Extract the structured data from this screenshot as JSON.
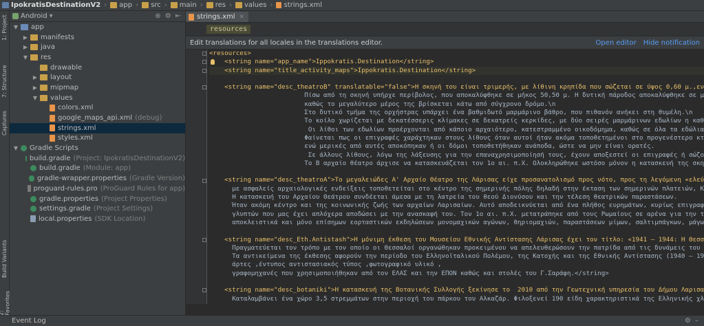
{
  "breadcrumbs": [
    "IpokratisDestinationV2",
    "app",
    "src",
    "main",
    "res",
    "values",
    "strings.xml"
  ],
  "left_toolwindows": [
    "1: Project",
    "7: Structure",
    "Captures",
    "Build Variants",
    "2: Favorites"
  ],
  "project_panel": {
    "view_mode": "Android",
    "tree": [
      {
        "label": "app",
        "hint": "",
        "indent": 0,
        "arrow": "▼",
        "icon": "folder-blue"
      },
      {
        "label": "manifests",
        "hint": "",
        "indent": 1,
        "arrow": "▶",
        "icon": "folder"
      },
      {
        "label": "java",
        "hint": "",
        "indent": 1,
        "arrow": "▶",
        "icon": "folder"
      },
      {
        "label": "res",
        "hint": "",
        "indent": 1,
        "arrow": "▼",
        "icon": "folder"
      },
      {
        "label": "drawable",
        "hint": "",
        "indent": 2,
        "arrow": "",
        "icon": "folder"
      },
      {
        "label": "layout",
        "hint": "",
        "indent": 2,
        "arrow": "▶",
        "icon": "folder"
      },
      {
        "label": "mipmap",
        "hint": "",
        "indent": 2,
        "arrow": "▶",
        "icon": "folder"
      },
      {
        "label": "values",
        "hint": "",
        "indent": 2,
        "arrow": "▼",
        "icon": "folder"
      },
      {
        "label": "colors.xml",
        "hint": "",
        "indent": 3,
        "arrow": "",
        "icon": "xml"
      },
      {
        "label": "google_maps_api.xml",
        "hint": "(debug)",
        "indent": 3,
        "arrow": "",
        "icon": "xml"
      },
      {
        "label": "strings.xml",
        "hint": "",
        "indent": 3,
        "arrow": "",
        "icon": "xml",
        "selected": true
      },
      {
        "label": "styles.xml",
        "hint": "",
        "indent": 3,
        "arrow": "",
        "icon": "xml"
      },
      {
        "label": "Gradle Scripts",
        "hint": "",
        "indent": 0,
        "arrow": "▼",
        "icon": "gradle"
      },
      {
        "label": "build.gradle",
        "hint": "(Project: IpokratisDestinationV2)",
        "indent": 1,
        "arrow": "",
        "icon": "gradle"
      },
      {
        "label": "build.gradle",
        "hint": "(Module: app)",
        "indent": 1,
        "arrow": "",
        "icon": "gradle"
      },
      {
        "label": "gradle-wrapper.properties",
        "hint": "(Gradle Version)",
        "indent": 1,
        "arrow": "",
        "icon": "gradle"
      },
      {
        "label": "proguard-rules.pro",
        "hint": "(ProGuard Rules for app)",
        "indent": 1,
        "arrow": "",
        "icon": "pro"
      },
      {
        "label": "gradle.properties",
        "hint": "(Project Properties)",
        "indent": 1,
        "arrow": "",
        "icon": "gradle"
      },
      {
        "label": "settings.gradle",
        "hint": "(Project Settings)",
        "indent": 1,
        "arrow": "",
        "icon": "gradle"
      },
      {
        "label": "local.properties",
        "hint": "(SDK Location)",
        "indent": 1,
        "arrow": "",
        "icon": "props"
      }
    ]
  },
  "editor": {
    "tab_label": "strings.xml",
    "breadcrumb_chip": "resources",
    "notice_text": "Edit translations for all locales in the translations editor.",
    "open_editor": "Open editor",
    "hide_notification": "Hide notification",
    "lines": [
      {
        "text": "<resources>",
        "kind": "tag"
      },
      {
        "text": "    <string name=\"app_name\">Ippokratis.Destination</string>",
        "kind": "str"
      },
      {
        "text": "    <string name=\"title_activity_maps\">Ippokratis.Destination</string>",
        "kind": "str",
        "highlight": true
      },
      {
        "text": "",
        "kind": "plain"
      },
      {
        "text": "    <string name=\"desc_theatroB\" translatable=\"false\">Η σκηνή του είναι τριμερής, με λίθινη κρηπίδα που σώζεται σε ύψος 0,60 μ.,ενώ το ανάτερ",
        "kind": "str"
      },
      {
        "text": "                         Πίσω από τη σκηνή υπήρχε περίβολος, που αποκαλύφθηκε σε μήκος 50,50 μ. Η δυτική πάροδος αποκαλύφθηκε σε μήκος 9 μ.,",
        "kind": "plain"
      },
      {
        "text": "                         καθώς το μεγαλύτερο μέρος της βρίσκεται κάτω από σύγχρονο δρόμο.\\n",
        "kind": "plain"
      },
      {
        "text": "                         Στο δυτικό τμήμα της ορχήστρας υπάρχει ένα βαθμιδωτό μαρμάρινο βάθρο, που πιθανόν ανήκει στη θυμέλη.\\n",
        "kind": "plain"
      },
      {
        "text": "                         Το κοίλο χωρίζεται με δεκατέσσερις κλίμακες σε δεκατρείς κερκίδες, με δύο σειρές μαρμάρινων εδωλίων η καθεμιά.",
        "kind": "plain"
      },
      {
        "text": "                          Οι λίθοι των εδωλίων προέρχονται από κάποιο αρχαιότερο, κατεστραμμένο οικοδόμημα, καθώς σε όλα τα εδώλια υπάρχουν απ",
        "kind": "plain"
      },
      {
        "text": "                         Φαίνεται πως οι επιγραφές χαράχτηκαν στους λίθους όταν αυτοί ήταν ακόμα τοποθετημένοι στο προγενέστερο κτίριο, επειδή",
        "kind": "plain"
      },
      {
        "text": "                         ενώ μερικές από αυτές αποκόπηκαν ή οι δόμοι τοποθετήθηκαν ανάποδα, ώστε να μην είναι ορατές.",
        "kind": "plain"
      },
      {
        "text": "                          Σε άλλους λίθους, λόγω της λάξευσης για την επαναχρησιμοποίησή τους, έχουν αποξεστεί οι επιγραφές ή σώζονται ελάχιστ",
        "kind": "plain"
      },
      {
        "text": "                         Το Β αρχαίο θέατρο άρχισε να κατασκευάζεται τον 1ο αι. π.Χ. Ολοκληρώθηκε ωστόσο μόνον η κατασκευή της σκηνής και της",
        "kind": "plain"
      },
      {
        "text": "",
        "kind": "plain"
      },
      {
        "text": "    <string name=\"desc_theatroA\">Το μεγαλειώδες Α' Αρχαίο Θέατρο της Λάρισας είχε προσανατολισμό προς νότο, προς τη λεγόμενη «ελεύθερη» αγορά",
        "kind": "str"
      },
      {
        "text": "      με ασφαλείς αρχαιολογικές ενδείξεις τοποθετείται στο κέντρο της σημερινής πόλης δηλαδή στην έκταση των σημερινών πλατειών, Κεντρικής",
        "kind": "plain"
      },
      {
        "text": "      Η κατασκευή του Αρχαίου Θεάτρου συνδέεται άμεσα με τη λατρεία του θεού Διονύσου και την τέλεση θεατρικών παραστάσεων.",
        "kind": "plain"
      },
      {
        "text": "      Ήταν ακόμη κέντρο και της κοινωνικής ζωής των αρχαίων Λαρισαίων. Αυτό αποδεικνύεται από ένα πλήθος ευρημάτων, κυρίως επιγραφών και",
        "kind": "plain"
      },
      {
        "text": "      γλυπτών που μας έχει απλόχερα αποδώσει με την ανασκαφή του. Τον 1ο αι. π.Χ. μετατράπηκε από τους Ρωμαίους σε αρένα για την τέλεση",
        "kind": "plain"
      },
      {
        "text": "      αποκλειστικά και μόνο επίσημων εορταστικών εκδηλώσεων μονομαχικών αγώνων, θηριομαχιών, παραστάσεων μίμων, σαλτιμπάγκων, μάγων και άλλ",
        "kind": "plain"
      },
      {
        "text": "",
        "kind": "plain"
      },
      {
        "text": "    <string name=\"desc_Eth.Antistash\">Η μόνιμη έκθεση του Μουσείου Εθνικής Αντίστασης Λάρισας έχει τον τίτλο: «1941 – 1944: Η Θεσσαλία αντιστ",
        "kind": "str"
      },
      {
        "text": "      Πραγματεύεται τον τρόπο με τον οποίο οι Θεσσαλοί οργανώθηκαν προκειμένου να απελευθερώσουν την πατρίδα από τις δυνάμεις του Άξονα.",
        "kind": "plain"
      },
      {
        "text": "      Τα αντικείμενα της έκθεσης αφορούν την περίοδο του Ελληνοϊταλικού Πολέμου, της Κατοχής και της Εθνικής Αντίστασης (1940 – 1944). Χ",
        "kind": "plain"
      },
      {
        "text": "      άρτες ,έντυπος αντιστασιακός τύπος ,φωτογραφικό υλικό ,",
        "kind": "plain"
      },
      {
        "text": "      γραφομηχανές που χρησιμοποιήθηκαν από τον ΕΛΑΣ και την ΕΠΟΝ καθώς και στολές του Γ.Σαράφη.</string>",
        "kind": "plain"
      },
      {
        "text": "",
        "kind": "plain"
      },
      {
        "text": "    <string name=\"desc_botaniki\">Η κατασκευή της Βοτανικής Συλλογής ξεκίνησε το  2010 από την Γεωτεχνική υπηρεσία του Δήμου Λαρισαίων.",
        "kind": "str"
      },
      {
        "text": "      Καταλαμβάνει ένα χώρο 3,5 στρεμμάτων στην περιοχή του πάρκου του Αλκαζάρ. Φιλοξενεί 190 είδη χαρακτηριστικά της Ελληνικής χλωρίδας, σ",
        "kind": "plain"
      }
    ]
  },
  "status": {
    "event_log": "Event Log"
  }
}
